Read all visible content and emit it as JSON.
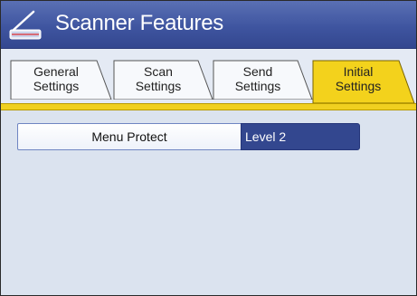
{
  "header": {
    "title": "Scanner Features",
    "icon": "scanner-icon"
  },
  "tabs": [
    {
      "line1": "General",
      "line2": "Settings",
      "selected": false
    },
    {
      "line1": "Scan",
      "line2": "Settings",
      "selected": false
    },
    {
      "line1": "Send",
      "line2": "Settings",
      "selected": false
    },
    {
      "line1": "Initial",
      "line2": "Settings",
      "selected": true
    }
  ],
  "settings": [
    {
      "label": "Menu Protect",
      "value": "Level 2"
    }
  ],
  "colors": {
    "header": "#3f55a0",
    "selected_tab": "#f0d020",
    "value_bg": "#33478f"
  }
}
